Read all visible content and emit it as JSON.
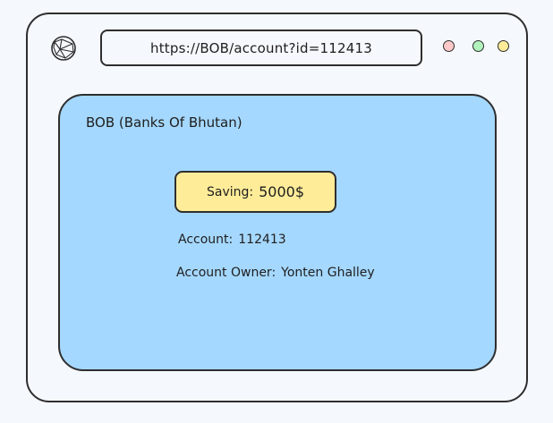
{
  "browser": {
    "url": "https://BOB/account?id=112413",
    "window_controls": [
      {
        "name": "close",
        "color": "#ffc9c9"
      },
      {
        "name": "maximize",
        "color": "#b2f2bb"
      },
      {
        "name": "minimize",
        "color": "#ffec99"
      }
    ],
    "site_icon": "globe-icon"
  },
  "page": {
    "bank_name": "BOB (Banks Of Bhutan)",
    "saving": {
      "label": "Saving:",
      "amount": "5000$"
    },
    "account": {
      "label": "Account:",
      "value": "112413"
    },
    "owner": {
      "label": "Account Owner:",
      "value": "Yonten Ghalley"
    }
  },
  "colors": {
    "page_background": "#f5f9fd",
    "content_background": "#a5d8ff",
    "saving_background": "#ffec99",
    "stroke": "#2e2e2e"
  }
}
